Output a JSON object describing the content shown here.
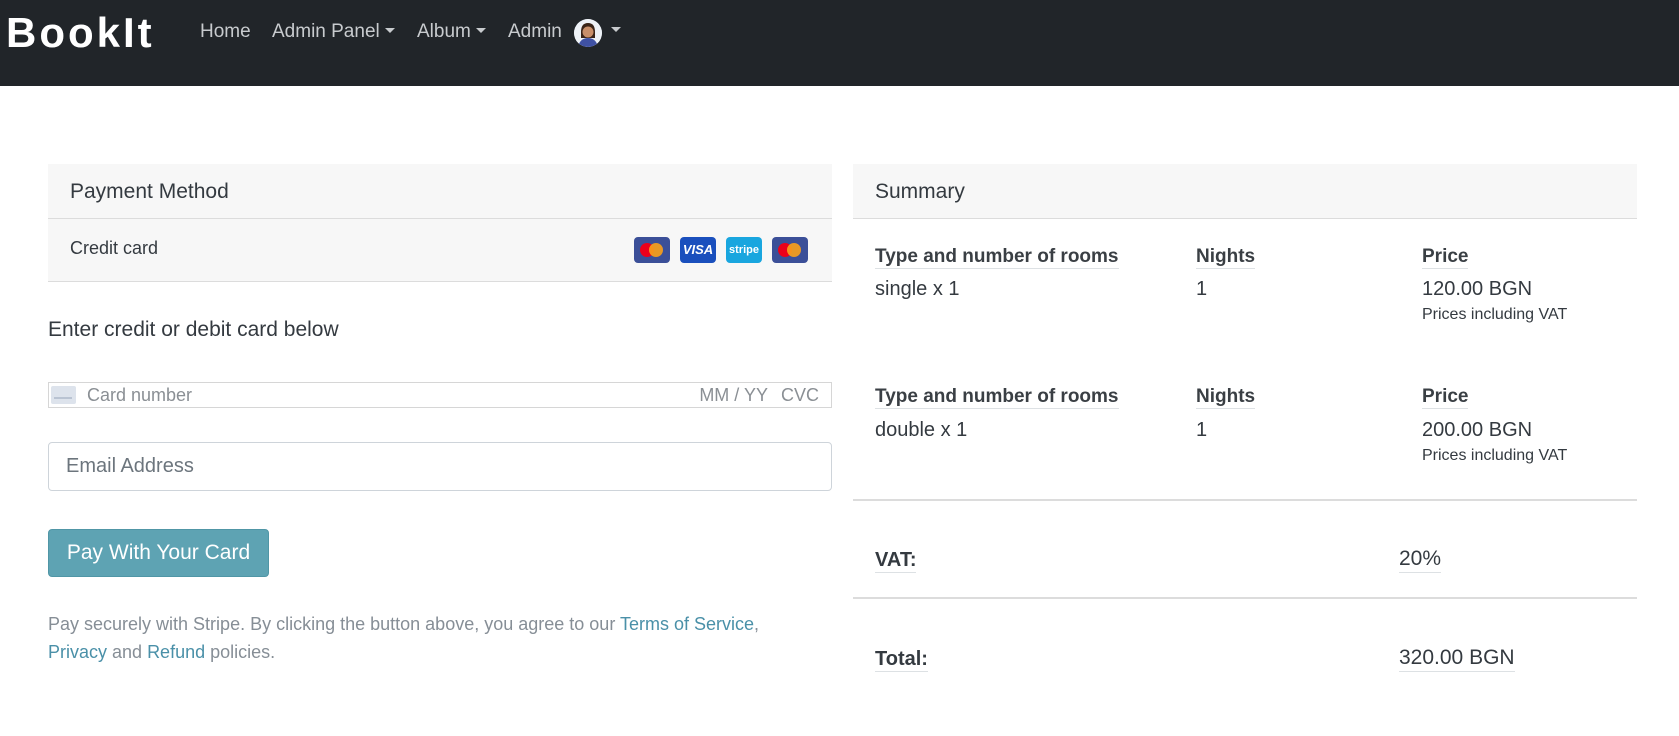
{
  "navbar": {
    "brand": "BookIt",
    "links": {
      "home": "Home",
      "admin_panel": "Admin Panel",
      "album": "Album",
      "admin": "Admin"
    }
  },
  "payment": {
    "header": "Payment Method",
    "method_label": "Credit card",
    "card_icons": [
      "mastercard-icon",
      "visa-icon",
      "stripe-icon",
      "mastercard-icon"
    ],
    "visa_text": "VISA",
    "stripe_text": "stripe",
    "enter_label": "Enter credit or debit card below",
    "card_number_placeholder": "Card number",
    "expiry_placeholder": "MM / YY",
    "cvc_placeholder": "CVC",
    "email_placeholder": "Email Address",
    "pay_button": "Pay With Your Card",
    "legal": {
      "prefix": "Pay securely with Stripe. By clicking the button above, you agree to our ",
      "terms": "Terms of Service",
      "comma": ",",
      "privacy": "Privacy",
      "and": " and ",
      "refund": "Refund",
      "suffix": " policies."
    }
  },
  "summary": {
    "header": "Summary",
    "col_type": "Type and number of rooms",
    "col_nights": "Nights",
    "col_price": "Price",
    "rows": [
      {
        "type": "single x 1",
        "nights": "1",
        "price": "120.00 BGN",
        "note": "Prices including VAT"
      },
      {
        "type": "double x 1",
        "nights": "1",
        "price": "200.00 BGN",
        "note": "Prices including VAT"
      }
    ],
    "vat_label": "VAT:",
    "vat_value": "20%",
    "total_label": "Total:",
    "total_value": "320.00 BGN"
  },
  "colors": {
    "navbar_bg": "#212529",
    "button_bg": "#5ea3b3",
    "link": "#4a90a8"
  }
}
